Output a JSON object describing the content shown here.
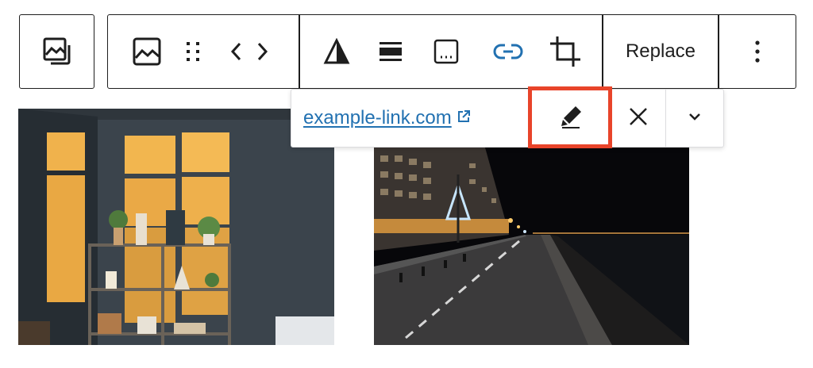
{
  "toolbar": {
    "replace_label": "Replace",
    "groups": [
      {
        "name": "block-switcher",
        "icons": [
          "image-stack-icon"
        ]
      },
      {
        "name": "block-tools",
        "icons": [
          "image-icon",
          "drag-handle-icon",
          "move-arrows-icon"
        ]
      },
      {
        "name": "image-tools",
        "icons": [
          "duotone-icon",
          "align-icon",
          "caption-icon",
          "link-icon",
          "crop-icon"
        ]
      },
      {
        "name": "replace",
        "icons": []
      },
      {
        "name": "more-options",
        "icons": [
          "more-vertical-icon"
        ]
      }
    ]
  },
  "link_popover": {
    "url": "example-link.com",
    "icons": [
      "external-link-icon",
      "edit-pencil-icon",
      "unlink-close-icon",
      "chevron-down-icon"
    ]
  },
  "colors": {
    "accent": "#2271b1",
    "highlight": "#e8442a",
    "border": "#1e1e1e"
  },
  "images": [
    {
      "name": "room-shelves-photo",
      "description_visible": false
    },
    {
      "name": "night-promenade-photo",
      "description_visible": false
    }
  ]
}
